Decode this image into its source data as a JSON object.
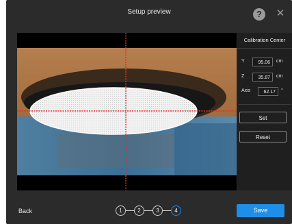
{
  "dialog": {
    "title": "Setup preview"
  },
  "icons": {
    "help": "?",
    "close": "✕"
  },
  "calibration": {
    "header": "Calibration Center",
    "y": {
      "label": "Y",
      "value": "95.06",
      "unit": "cm"
    },
    "z": {
      "label": "Z",
      "value": "35.87",
      "unit": "cm"
    },
    "axis": {
      "label": "Axis",
      "value": "62.17",
      "unit": "°"
    },
    "set_label": "Set",
    "reset_label": "Reset"
  },
  "footer": {
    "back_label": "Back",
    "steps": [
      "1",
      "2",
      "3",
      "4"
    ],
    "active_step": "4",
    "save_label": "Save"
  },
  "colors": {
    "accent": "#1e8ee8",
    "crosshair": "#e0302a",
    "background": "#2b2b2b"
  }
}
